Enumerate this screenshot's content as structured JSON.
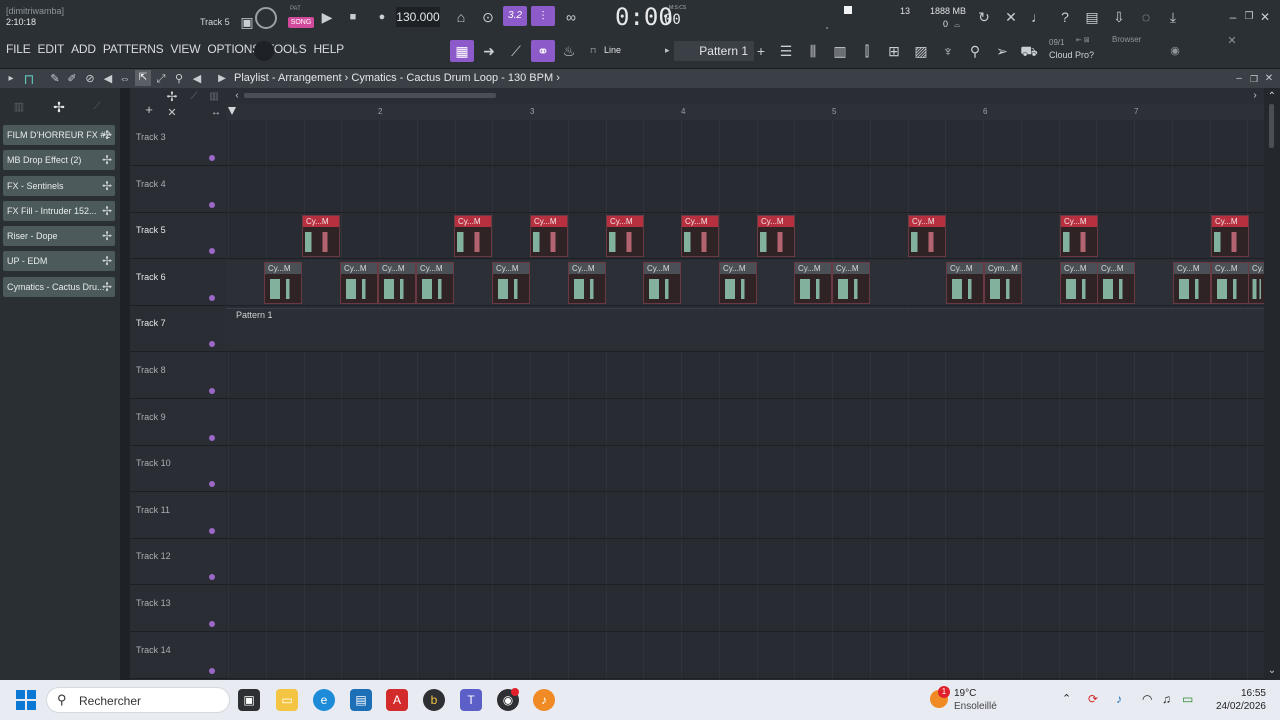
{
  "app": {
    "user": "[dimitriwamba]",
    "time_position": "2:10:18",
    "track_hint": "Track 5",
    "tempo": "130.000",
    "clock": "0:00",
    "clock_sub": "00",
    "clock_label": "M:S:CS",
    "pat_label": "PAT",
    "song_label": "SONG",
    "cpu": "13",
    "memory": "1888 MB",
    "memory_sub": "0",
    "step_value": "3.2",
    "snap_mode": "Line",
    "pattern_selector": "Pattern 1",
    "news_date": "09/1",
    "news_title": "Cloud Pro?",
    "browser_label": "Browser"
  },
  "menu": [
    "FILE",
    "EDIT",
    "ADD",
    "PATTERNS",
    "VIEW",
    "OPTIONS",
    "TOOLS",
    "HELP"
  ],
  "playlist": {
    "title": "Playlist - Arrangement",
    "separator": "›",
    "clip_source": "Cymatics - Cactus Drum Loop - 130 BPM",
    "arrow": "›"
  },
  "ruler": [
    "2",
    "3",
    "4",
    "5",
    "6",
    "7"
  ],
  "sidebar_patterns": [
    "FILM D'HORREUR FX #2",
    "MB Drop Effect (2)",
    "FX - Sentinels",
    "FX Fill - Intruder 152...",
    "Riser - Dope",
    "UP - EDM",
    "Cymatics - Cactus Dru..."
  ],
  "tracks": [
    "Track 3",
    "Track 4",
    "Track 5",
    "Track 6",
    "Track 7",
    "Track 8",
    "Track 9",
    "Track 10",
    "Track 11",
    "Track 12",
    "Track 13",
    "Track 14"
  ],
  "clip_label": "Cy...M",
  "clip_label_alt": "Cym...M",
  "pattern_clip_label": "Pattern 1",
  "taskbar": {
    "search_placeholder": "Rechercher",
    "weather_temp": "19°C",
    "weather_desc": "Ensoleillé",
    "weather_badge": "1",
    "time": "16:55",
    "date": "24/02/2026"
  },
  "colors": {
    "clip_red": "#b7303f",
    "clip_grey": "#4a5055",
    "accent_purple": "#9b68c8",
    "song_pink": "#d14a9c"
  }
}
